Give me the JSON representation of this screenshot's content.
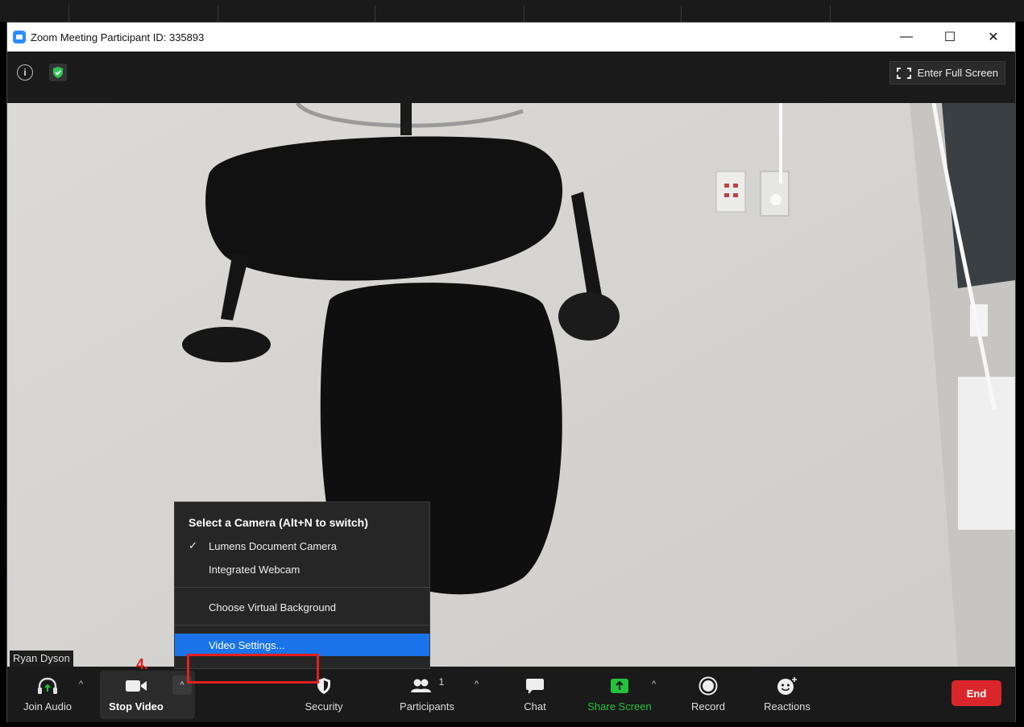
{
  "window": {
    "title": "Zoom Meeting Participant ID: 335893",
    "minimize": "—",
    "maximize": "☐",
    "close": "✕"
  },
  "topbar": {
    "fullscreen_label": "Enter Full Screen"
  },
  "video": {
    "participant_name": "Ryan Dyson"
  },
  "camera_menu": {
    "header": "Select a Camera (Alt+N to switch)",
    "items": [
      {
        "label": "Lumens Document Camera",
        "checked": true
      },
      {
        "label": "Integrated Webcam",
        "checked": false
      }
    ],
    "virtual_background": "Choose Virtual Background",
    "video_settings": "Video Settings...",
    "check_mark": "✓"
  },
  "annotation": {
    "step": "4."
  },
  "toolbar": {
    "join_audio": "Join Audio",
    "stop_video": "Stop Video",
    "security": "Security",
    "participants": "Participants",
    "participants_count": "1",
    "chat": "Chat",
    "share_screen": "Share Screen",
    "record": "Record",
    "reactions": "Reactions",
    "end": "End",
    "caret": "^"
  },
  "colors": {
    "accent": "#1a73e8",
    "end": "#d9262b",
    "share": "#25c23c",
    "highlight": "#e41f1f"
  }
}
